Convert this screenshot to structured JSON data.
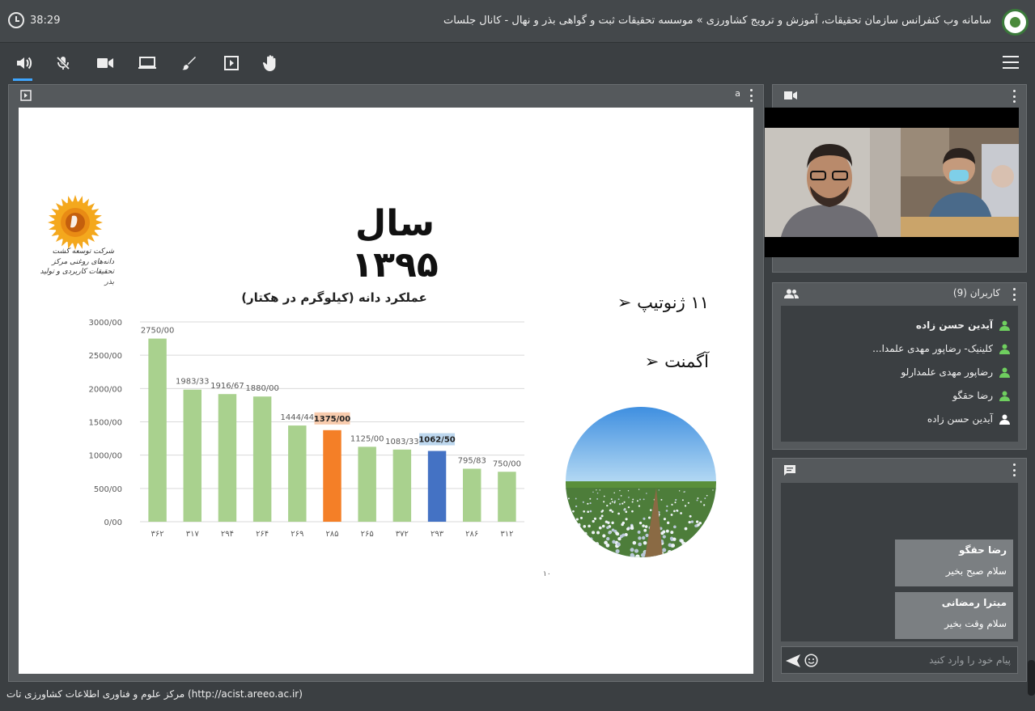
{
  "header": {
    "timer": "38:29",
    "title": "سامانه وب کنفرانس سازمان تحقیقات، آموزش و ترویج کشاورزی » موسسه تحقیقات ثبت و گواهی بذر و نهال - کانال جلسات"
  },
  "toolbar": {
    "buttons": [
      "speaker-icon",
      "mic-muted-icon",
      "camera-icon",
      "screen-share-icon",
      "brush-icon",
      "presentation-icon",
      "raise-hand-icon"
    ]
  },
  "presentation": {
    "header_letter": "a",
    "slide": {
      "title": "سال ۱۳۹۵",
      "bullets": [
        "۱۱ ژنوتیپ",
        "آگمنت"
      ],
      "logo_text": "شرکت توسعه کشت دانه‌های روغنی مرکز تحقیقات کاربردی و تولید بذر",
      "page_number": "۱۰"
    }
  },
  "chart_data": {
    "type": "bar",
    "title": "عملکرد دانه (کیلوگرم در هکتار)",
    "categories": [
      "۳۶۲",
      "۳۱۷",
      "۲۹۴",
      "۲۶۴",
      "۲۶۹",
      "۲۸۵",
      "۲۶۵",
      "۳۷۲",
      "۲۹۳",
      "۲۸۶",
      "۳۱۲"
    ],
    "values": [
      2750,
      1983.33,
      1916.67,
      1880,
      1444.44,
      1375,
      1125,
      1083.33,
      1062.5,
      795.83,
      750
    ],
    "data_labels": [
      "2750/00",
      "1983/33",
      "1916/67",
      "1880/00",
      "1444/44",
      "1375/00",
      "1125/00",
      "1083/33",
      "1062/50",
      "795/83",
      "750/00"
    ],
    "y_ticks": [
      "0/00",
      "500/00",
      "1000/00",
      "1500/00",
      "2000/00",
      "2500/00",
      "3000/00"
    ],
    "ylim": [
      0,
      3000
    ],
    "colors": {
      "default": "#a9d18e",
      "highlight_orange": "#f47f27",
      "highlight_blue": "#4472c4",
      "orange_label_bg": "#f8cbad",
      "blue_label_bg": "#bdd7ee"
    },
    "highlight": {
      "5": "orange",
      "8": "blue"
    },
    "grid": true
  },
  "video": {
    "tiles": 2
  },
  "users": {
    "title": "کاربران (9)",
    "list": [
      {
        "name": "آیدین حسن زاده",
        "bold": true,
        "color": "#6fcf5f"
      },
      {
        "name": "کلینیک- رضاپور مهدی علمدا...",
        "bold": false,
        "color": "#6fcf5f"
      },
      {
        "name": "رضاپور مهدی علمدارلو",
        "bold": false,
        "color": "#6fcf5f"
      },
      {
        "name": "رضا حقگو",
        "bold": false,
        "color": "#6fcf5f"
      },
      {
        "name": "آیدین حسن زاده",
        "bold": false,
        "color": "#ffffff"
      }
    ]
  },
  "chat": {
    "messages": [
      {
        "sender": "رضا حقگو",
        "text": "سلام صبح بخیر"
      },
      {
        "sender": "میترا رمضانی",
        "text": "سلام وقت بخیر"
      }
    ],
    "placeholder": "پیام خود را وارد کنید"
  },
  "footer": {
    "text": "مرکز علوم و فناوری اطلاعات کشاورزی تات (http://acist.areeo.ac.ir)"
  }
}
